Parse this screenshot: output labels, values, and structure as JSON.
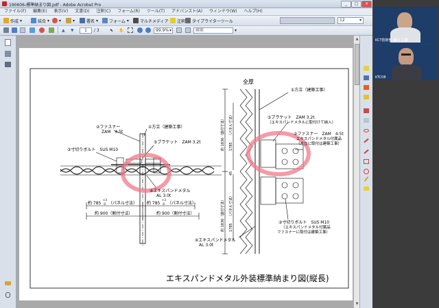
{
  "window": {
    "title": "190606-標準納まり図.pdf - Adobe Acrobat Pro",
    "controls": [
      "_",
      "□",
      "×"
    ]
  },
  "menu": {
    "items": [
      "ファイル(F)",
      "編集(E)",
      "表示(V)",
      "文書(D)",
      "注釈(C)",
      "フォーム(R)",
      "ツール(T)",
      "アドバンスト(A)",
      "ウィンドウ(W)",
      "ヘルプ(H)"
    ]
  },
  "toolbar1": {
    "create": "作成",
    "combine": "結合",
    "sign": "署名",
    "forms": "フォーム",
    "multimedia": "マルチメディア",
    "comment": "注釈",
    "typewriter": "タイプライターツール",
    "zoom_value": "12"
  },
  "toolbar2": {
    "page_current": "1",
    "page_total": "/ 3",
    "zoom": "99.9%",
    "search_placeholder": "検索"
  },
  "drawing": {
    "title": "エキスパンドメタル外装標準納まり図(縦長)",
    "heading_right": "全厚",
    "labels_left": {
      "fastener": "②ファスナー",
      "fastener_spec": "ZAM　4.5t",
      "column": "①方立（建築工事）",
      "bracket": "⑤ブラケット　ZAM 3.2t",
      "bolt": "③寸切りボルト　SUS M10",
      "metal": "④エキスパンドメタル",
      "metal_spec": "AL 3.0t",
      "panel1": "約 785",
      "panel1_sup": "+3",
      "panel1_sub": "-0",
      "panel1_note": "（パネル寸法）",
      "panel2": "約 785",
      "panel2_sup": "+3",
      "panel2_sub": "-0",
      "panel2_note": "（パネル寸法）",
      "split1": "約 900（割付寸法）",
      "split2": "約 900（割付寸法）"
    },
    "labels_right": {
      "column": "①方立（建築工事）",
      "bracket": "⑤ブラケット　ZAM 3.2t",
      "bracket_note": "（エキスパンドメタルに取付けて納入）",
      "fastener": "②ファスナー　ZAM　4.5t",
      "fastener_note1": "エキスパンドメタル付属品",
      "fastener_note2": "（方立に取付は建築工事）",
      "bolt": "③寸切りボルト　SUS M10",
      "bolt_note1": "（エキスパンドメタル付属品",
      "bolt_note2": "ファスナーに取付は建築工事）",
      "metal": "④エキスパンドメタル",
      "metal_spec": "AL 3.0t",
      "dim1": "約 1830（割付寸法）",
      "dim1b": "1785",
      "dim1c": "（パネル寸法）",
      "dim2": "約 1830（割付寸法）",
      "dim2b": "1785",
      "dim2c": "（パネル寸法）",
      "dim_gap": "45"
    }
  },
  "video": {
    "participant1": "KCT技術部 菊川 工業",
    "participant2": "KTC08"
  },
  "colors": {
    "highlight": "#f07a88",
    "video_bg": "#1e3d68"
  }
}
